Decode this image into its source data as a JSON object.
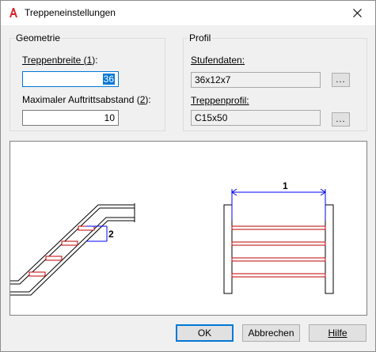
{
  "window": {
    "title": "Treppeneinstellungen"
  },
  "geometry": {
    "group_title": "Geometrie",
    "width_label_prefix": "Treppenbreite (",
    "width_label_key": "1",
    "width_label_suffix": "):",
    "width_value": "36",
    "distance_label_prefix": "Maximaler Auftrittsabstand (",
    "distance_label_key": "2",
    "distance_label_suffix": "):",
    "distance_value": "10"
  },
  "profile": {
    "group_title": "Profil",
    "tread_label": "Stufendaten:",
    "tread_value": "36x12x7",
    "stair_profile_label": "Treppenprofil:",
    "stair_profile_value": "C15x50",
    "browse_label": "..."
  },
  "preview": {
    "dimension_1": "1",
    "dimension_2": "2",
    "accent_color": "#0000ff",
    "tread_color": "#c00000"
  },
  "buttons": {
    "ok": "OK",
    "cancel": "Abbrechen",
    "help": "Hilfe"
  }
}
